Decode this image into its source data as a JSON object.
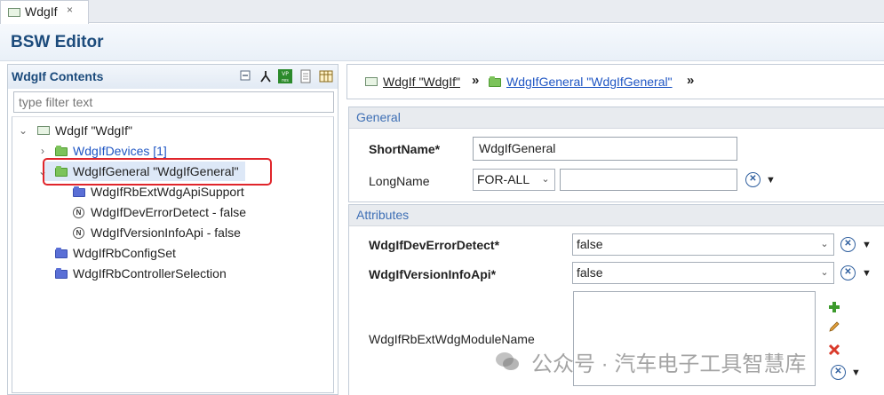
{
  "tab": {
    "label": "WdgIf",
    "close_glyph": "×"
  },
  "editor": {
    "title": "BSW Editor"
  },
  "contents": {
    "title": "WdgIf Contents",
    "filter_placeholder": "type filter text",
    "toolbar_icons": [
      "collapse-all-icon",
      "hierarchy-icon",
      "variant-resources-icon",
      "document-icon",
      "table-view-icon"
    ]
  },
  "tree": {
    "root": "WdgIf \"WdgIf\"",
    "devices": "WdgIfDevices [1]",
    "general": "WdgIfGeneral \"WdgIfGeneral\"",
    "general_children": [
      "WdgIfRbExtWdgApiSupport",
      "WdgIfDevErrorDetect - false",
      "WdgIfVersionInfoApi - false"
    ],
    "config_set": "WdgIfRbConfigSet",
    "controller_selection": "WdgIfRbControllerSelection"
  },
  "breadcrumb": {
    "items": [
      "WdgIf \"WdgIf\"",
      "WdgIfGeneral \"WdgIfGeneral\""
    ],
    "separator": "»"
  },
  "general_section": {
    "title": "General",
    "shortname_label": "ShortName*",
    "shortname_value": "WdgIfGeneral",
    "longname_label": "LongName",
    "longname_lang": "FOR-ALL",
    "longname_value": ""
  },
  "attributes_section": {
    "title": "Attributes",
    "dev_error_label": "WdgIfDevErrorDetect*",
    "dev_error_value": "false",
    "version_info_label": "WdgIfVersionInfoApi*",
    "version_info_value": "false",
    "ext_module_label": "WdgIfRbExtWdgModuleName"
  },
  "watermark": {
    "text": "公众号 · 汽车电子工具智慧库"
  },
  "colors": {
    "accent": "#1c4b7c",
    "link": "#1f56c4",
    "highlight_box": "#e0252b",
    "section_title": "#3e6fb5"
  }
}
